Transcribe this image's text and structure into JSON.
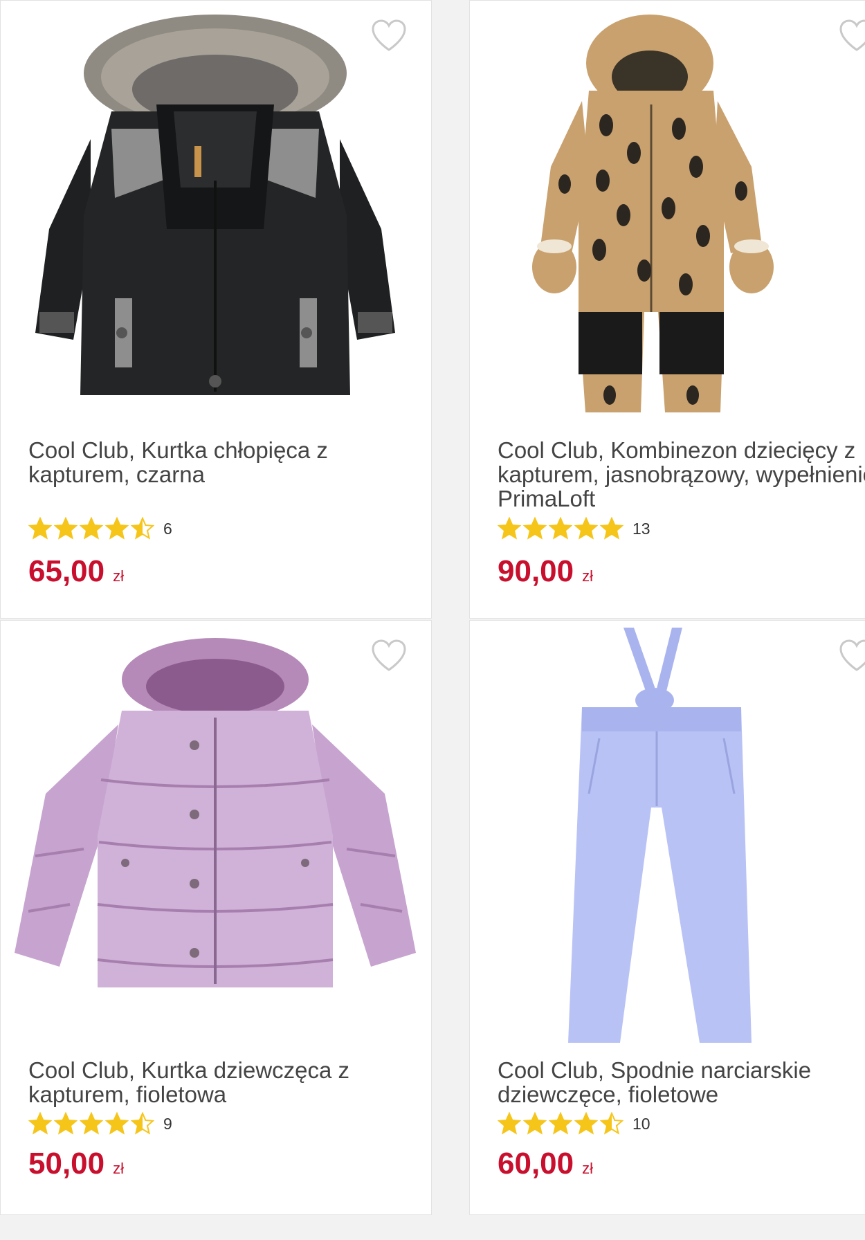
{
  "products": [
    {
      "title": "Cool Club, Kurtka chłopięca z kapturem, czarna",
      "rating_value": 4.5,
      "rating_count": "6",
      "price": "65,00",
      "currency": "zł",
      "image_icon": "black-boys-winter-jacket-with-fur-hood"
    },
    {
      "title": "Cool Club, Kombinezon dziecięcy z kapturem, jasnobrązowy, wypełnienie PrimaLoft",
      "rating_value": 5,
      "rating_count": "13",
      "price": "90,00",
      "currency": "zł",
      "image_icon": "beige-penguin-print-snowsuit"
    },
    {
      "title": "Cool Club, Kurtka dziewczęca z kapturem, fioletowa",
      "rating_value": 4.5,
      "rating_count": "9",
      "price": "50,00",
      "currency": "zł",
      "image_icon": "purple-shiny-puffer-jacket"
    },
    {
      "title": "Cool Club, Spodnie narciarskie dziewczęce, fioletowe",
      "rating_value": 4.5,
      "rating_count": "10",
      "price": "60,00",
      "currency": "zł",
      "image_icon": "lavender-ski-pants-with-braces"
    }
  ],
  "colors": {
    "price": "#c8102e",
    "star": "#f6c51a",
    "heart": "#c9c9c9",
    "page_bg": "#f2f2f2"
  },
  "wishlist_icon": "heart-outline-icon"
}
